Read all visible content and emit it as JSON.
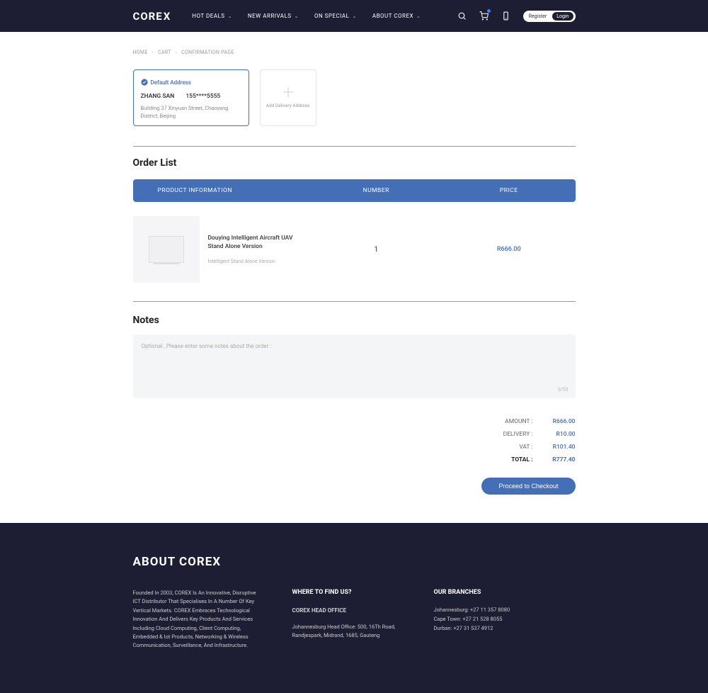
{
  "header": {
    "logo": "COREX",
    "nav": [
      "HOT DEALS",
      "NEW ARRIVALS",
      "ON SPECIAL",
      "ABOUT COREX"
    ],
    "register": "Register",
    "login": "Login"
  },
  "breadcrumbs": {
    "home": "HOME",
    "cart": "CART",
    "page": "CONFIRMATION PAGE"
  },
  "address": {
    "default_label": "Default Address",
    "name": "ZHANG SAN",
    "phone": "155****5555",
    "text": "Building 37 Xinyuan Street, Chaoyang District, Beijing",
    "add_label": "Add Delivery Address"
  },
  "order": {
    "title": "Order List",
    "head_info": "PRODUCT INFORMATION",
    "head_num": "NUMBER",
    "head_price": "PRICE",
    "items": [
      {
        "name": "Douying Intelligent Aircraft UAV Stand Alone Version",
        "sub": "Intelligent Stand Alone Version",
        "qty": "1",
        "price": "R666.00"
      }
    ]
  },
  "notes": {
    "title": "Notes",
    "placeholder": "Optional , Please enter some notes about the order :",
    "counter": "0/50"
  },
  "totals": {
    "amount_lbl": "AMOUNT :",
    "amount_val": "R666.00",
    "delivery_lbl": "DELIVERY :",
    "delivery_val": "R10.00",
    "vat_lbl": "VAT :",
    "vat_val": "R101.40",
    "total_lbl": "TOTAL :",
    "total_val": "R777.40",
    "checkout": "Proceed to Checkout"
  },
  "footer": {
    "heading": "ABOUT COREX",
    "about": "Founded In 2003, COREX Is An Innovative, Disruptive ICT Distributor That Specialises In A Number Of Key Vertical Markets. COREX Embraces Technological Innovation And Delivers Key Products And Services Including Cloud Computing, Client Computing, Embedded & Iot Products, Networking & Wireless Communication, Surveillance, And Infrastructure.",
    "where_title": "WHERE TO FIND US?",
    "where_sub": "COREX HEAD OFFICE",
    "where_addr": "Johannesburg Head Office: 500, 16Th Road, Randjespark, Midrand, 1685, Gauteng",
    "branches_title": "OUR BRANCHES",
    "b1": "Johannesburg: +27 11 357 8080",
    "b2": "Cape Town: +27 21 528 8055",
    "b3": "Durban: +27 31 537 4912"
  }
}
